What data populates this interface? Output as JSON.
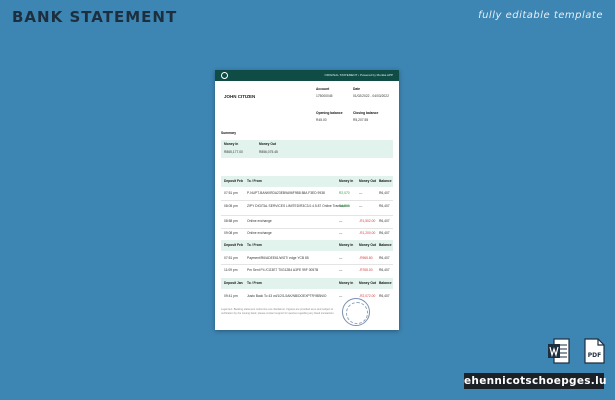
{
  "header": {
    "title": "BANK STATEMENT",
    "subtitle": "fully editable template"
  },
  "statement": {
    "top_bar_text": "ORIGINAL STATEMENT • Powered by Monika APP",
    "holder_name": "JOHN CITIZEN",
    "account": {
      "label": "Account",
      "value": "175000045"
    },
    "date": {
      "label": "Date",
      "value": "01/02/2022 - 04/03/2022"
    },
    "opening_balance": {
      "label": "Opening balance",
      "value": "R45.00"
    },
    "closing_balance": {
      "label": "Closing balance",
      "value": "R5,207.55"
    },
    "summary": {
      "label": "Summary",
      "money_in_label": "Money In",
      "money_out_label": "Money Out",
      "money_in_value": "R865,177.00",
      "money_out_value": "R856,075.45"
    },
    "table_headers": {
      "col1": "Deposit Feb",
      "col2": "To / From",
      "col3": "Money In",
      "col4": "Money Out",
      "col5": "Balance"
    },
    "section1_rows": [
      {
        "time": "07:51 pm",
        "desc": "P-NUPT-BANKIRDA23EB9A96F9B8 88A F3ED 9938",
        "in": "R2,070",
        "out": "—",
        "bal": "R6,407"
      },
      {
        "time": "08:05 pm",
        "desc": "ZIPY DIGITAL SERVICES LIMITED/R3C3.0.4.5.87 Online Transaction",
        "in": "R4,500",
        "out": "—",
        "bal": "R6,407"
      },
      {
        "time": "08:58 pm",
        "desc": "Online exchange",
        "in": "—",
        "out": "-R1,502.00",
        "bal": "R6,407"
      },
      {
        "time": "09:08 pm",
        "desc": "Online exchange",
        "in": "—",
        "out": "-R1,200.00",
        "bal": "R6,407"
      }
    ],
    "section2_headers": {
      "col1": "Deposit Feb",
      "col2": "To / From",
      "col3": "Money In",
      "col4": "Money Out",
      "col5": "Balance"
    },
    "section2_rows": [
      {
        "time": "07:51 pm",
        "desc": "Payment/R6/ADEE61/WGT/ edge YCB 85",
        "in": "—",
        "out": "-R965.80",
        "bal": "R6,407"
      },
      {
        "time": "11:09 pm",
        "desc": "Pm Sent P4 /CG3E7 T0G12B4 A3FE 99F 0057B",
        "in": "—",
        "out": "-R765.00",
        "bal": "R6,407"
      }
    ],
    "section3_headers": {
      "col1": "Deposit Jan",
      "col2": "To / From",
      "col3": "Money In",
      "col4": "Money Out",
      "col5": "Balance"
    },
    "section3_rows": [
      {
        "time": "09:41 pm",
        "desc": "Justo Back To 43 vd/1/2/1/JAK/NB/DOEXPTRYBBNIO",
        "in": "—",
        "out": "-R2,072.00",
        "bal": "R6,407"
      }
    ],
    "footer_text": "Legal text: Banking statement notice line one disclaimer. Figures are provided as-is and subject to verification by the issuing bank; please contact support for queries regarding any listed transaction."
  },
  "icons": {
    "word": "word-document-icon",
    "pdf": "pdf-document-icon"
  },
  "brand": "ehennicotschoepges.lu",
  "colors": {
    "background": "#3d85b3",
    "doc_header": "#0f4c46",
    "band": "#e2f2ec",
    "money_out": "#d23b3b",
    "money_in": "#2d9a45"
  }
}
